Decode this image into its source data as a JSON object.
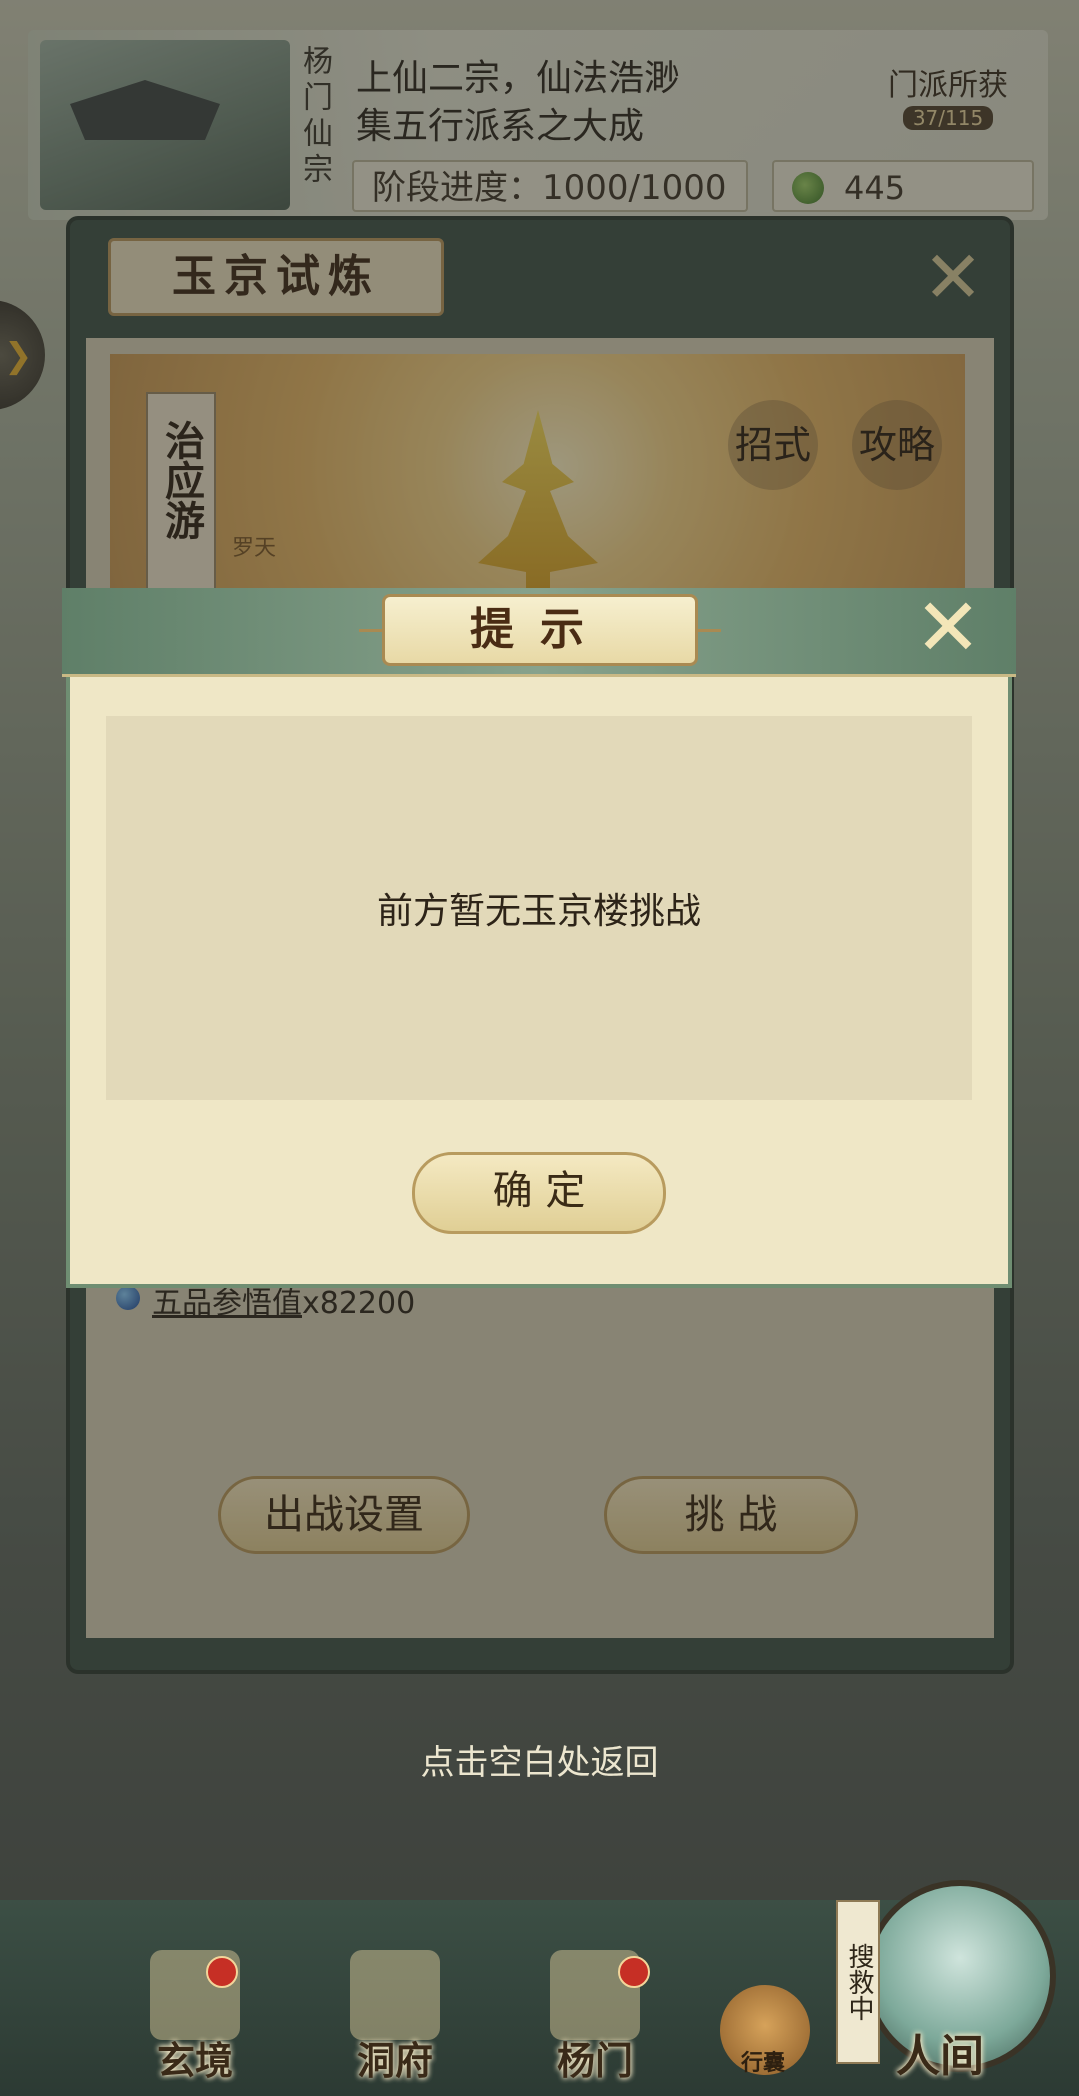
{
  "sect": {
    "name": "杨门仙宗",
    "desc_line1": "上仙二宗，仙法浩渺",
    "desc_line2": "集五行派系之大成",
    "progress_label": "阶段进度：1000/1000",
    "gem_count": "445",
    "reward_title": "门派所获",
    "reward_count": "37/115"
  },
  "trial": {
    "title": "玉京试炼",
    "boss_name": "治应游",
    "boss_sub": "罗天",
    "skills_label": "招式",
    "guide_label": "攻略",
    "reward_name": "五品参悟值",
    "reward_qty": "x82200",
    "battle_setup_label": "出战设置",
    "challenge_label": "挑 战"
  },
  "back_hint": "点击空白处返回",
  "modal": {
    "title": "提示",
    "message": "前方暂无玉京楼挑战",
    "confirm_label": "确 定"
  },
  "nav": {
    "items": [
      {
        "label": "玄境",
        "badge": true
      },
      {
        "label": "洞府",
        "badge": false
      },
      {
        "label": "杨门",
        "badge": true
      }
    ],
    "bag_label": "行囊",
    "search_tag": "搜救中",
    "world_label": "人间"
  }
}
